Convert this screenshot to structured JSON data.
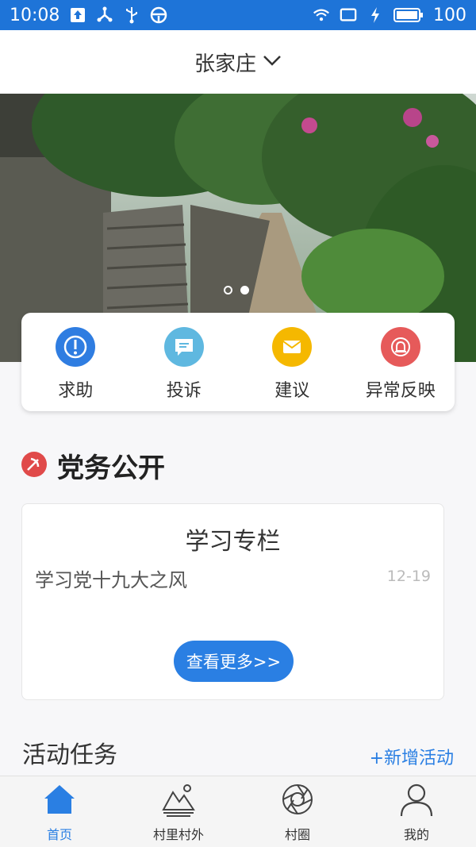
{
  "status_bar": {
    "time": "10:08",
    "battery": "100"
  },
  "header": {
    "location": "张家庄"
  },
  "banner": {
    "slides": 2,
    "active_slide": 2
  },
  "quick_actions": [
    {
      "label": "求助",
      "icon": "alert-icon",
      "color": "#2f7de1"
    },
    {
      "label": "投诉",
      "icon": "chat-icon",
      "color": "#5fb8e0"
    },
    {
      "label": "建议",
      "icon": "mail-icon",
      "color": "#f5b800"
    },
    {
      "label": "异常反映",
      "icon": "bell-icon",
      "color": "#e65a5a"
    }
  ],
  "party_section": {
    "title": "党务公开",
    "icon_color": "#e04a4a"
  },
  "study_card": {
    "title": "学习专栏",
    "item": "学习党十九大之风",
    "date": "12-19",
    "more_button": "查看更多>>"
  },
  "activity": {
    "title": "活动任务",
    "add_label": "+新增活动"
  },
  "tabs": [
    {
      "label": "首页",
      "icon": "home-icon",
      "active": true
    },
    {
      "label": "村里村外",
      "icon": "mountain-icon",
      "active": false
    },
    {
      "label": "村圈",
      "icon": "aperture-icon",
      "active": false
    },
    {
      "label": "我的",
      "icon": "user-icon",
      "active": false
    }
  ],
  "colors": {
    "primary": "#1e74d8",
    "accent": "#2a7fe3"
  }
}
